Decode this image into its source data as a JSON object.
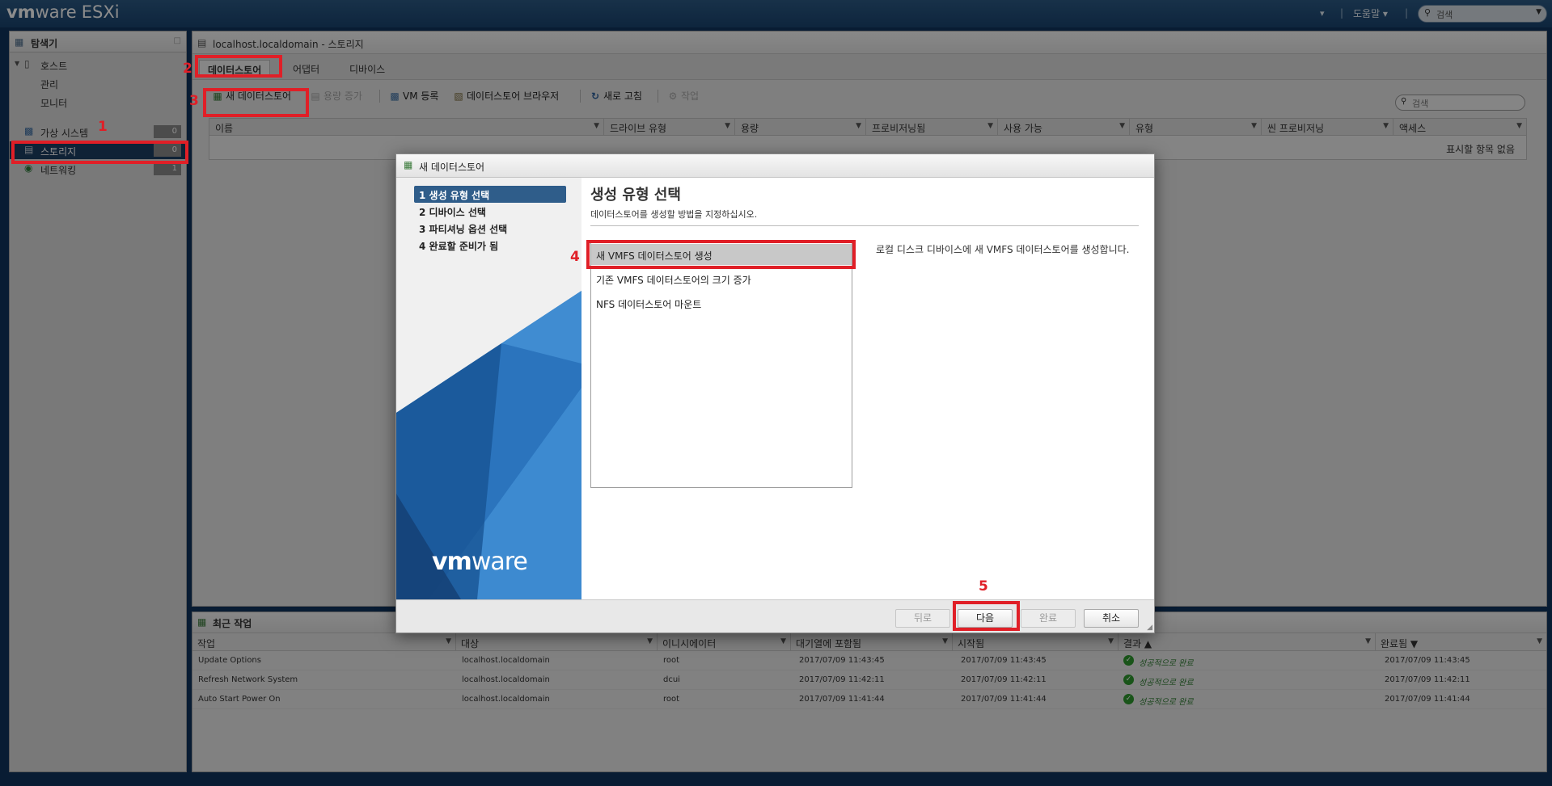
{
  "app": {
    "logo_vm": "vm",
    "logo_ware": "ware",
    "logo_product": "ESXi",
    "user_caret": "▾",
    "help_label": "도움말 ▾",
    "search_placeholder": "검색"
  },
  "navigator": {
    "title": "탐색기",
    "items": [
      {
        "label": "호스트",
        "badge": ""
      },
      {
        "label": "관리",
        "badge": ""
      },
      {
        "label": "모니터",
        "badge": ""
      },
      {
        "label": "가상 시스템",
        "badge": "0"
      },
      {
        "label": "스토리지",
        "badge": "0"
      },
      {
        "label": "네트워킹",
        "badge": "1"
      }
    ]
  },
  "main": {
    "title": "localhost.localdomain - 스토리지",
    "tabs": [
      "데이터스토어",
      "어댑터",
      "디바이스"
    ],
    "toolbar": {
      "new_datastore": "새 데이터스토어",
      "increase_capacity": "용량 증가",
      "register_vm": "VM 등록",
      "datastore_browser": "데이터스토어 브라우저",
      "refresh": "새로 고침",
      "actions": "작업"
    },
    "search_placeholder": "검색",
    "columns": [
      "이름",
      "드라이브 유형",
      "용량",
      "프로비저닝됨",
      "사용 가능",
      "유형",
      "씬 프로비저닝",
      "액세스"
    ],
    "empty_text": "표시할 항목 없음"
  },
  "tasks": {
    "title": "최근 작업",
    "columns": [
      "작업",
      "대상",
      "이니시에이터",
      "대기열에 포함됨",
      "시작됨",
      "결과 ▲",
      "완료됨 ▼"
    ],
    "rows": [
      {
        "task": "Update Options",
        "target": "localhost.localdomain",
        "initiator": "root",
        "queued": "2017/07/09 11:43:45",
        "started": "2017/07/09 11:43:45",
        "result": "성공적으로 완료",
        "completed": "2017/07/09 11:43:45"
      },
      {
        "task": "Refresh Network System",
        "target": "localhost.localdomain",
        "initiator": "dcui",
        "queued": "2017/07/09 11:42:11",
        "started": "2017/07/09 11:42:11",
        "result": "성공적으로 완료",
        "completed": "2017/07/09 11:42:11"
      },
      {
        "task": "Auto Start Power On",
        "target": "localhost.localdomain",
        "initiator": "root",
        "queued": "2017/07/09 11:41:44",
        "started": "2017/07/09 11:41:44",
        "result": "성공적으로 완료",
        "completed": "2017/07/09 11:41:44"
      }
    ]
  },
  "dialog": {
    "title": "새 데이터스토어",
    "steps": [
      "1 생성 유형 선택",
      "2 디바이스 선택",
      "3 파티셔닝 옵션 선택",
      "4 완료할 준비가 됨"
    ],
    "content_title": "생성 유형 선택",
    "content_subtitle": "데이터스토어를 생성할 방법을 지정하십시오.",
    "options": [
      "새 VMFS 데이터스토어 생성",
      "기존 VMFS 데이터스토어의 크기 증가",
      "NFS 데이터스토어 마운트"
    ],
    "option_description": "로컬 디스크 디바이스에 새 VMFS 데이터스토어를 생성합니다.",
    "logo_vm": "vm",
    "logo_ware": "ware",
    "buttons": {
      "back": "뒤로",
      "next": "다음",
      "finish": "완료",
      "cancel": "취소"
    }
  },
  "annotations": [
    "1",
    "2",
    "3",
    "4",
    "5"
  ],
  "colors": {
    "annotation_red": "#e01f27",
    "selected_nav": "#1d3f63",
    "active_step": "#2f5d8a",
    "success_green": "#2e9a2e"
  }
}
